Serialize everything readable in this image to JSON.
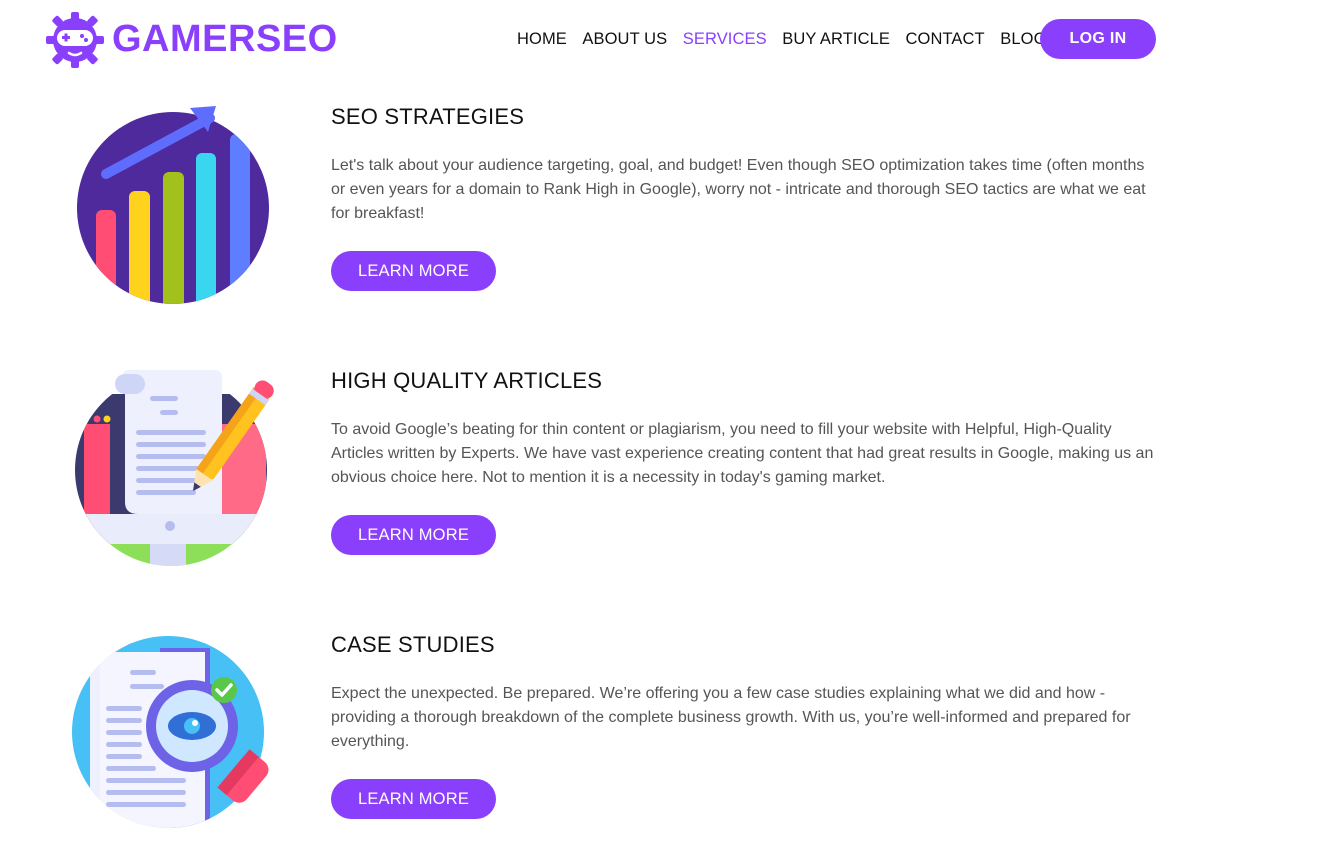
{
  "brand": {
    "name": "GAMERSEO",
    "logo_icon": "gamepad-gear-icon",
    "color": "#8a3ffc"
  },
  "nav": {
    "items": [
      {
        "label": "HOME",
        "active": false
      },
      {
        "label": "ABOUT US",
        "active": false
      },
      {
        "label": "SERVICES",
        "active": true
      },
      {
        "label": "BUY ARTICLE",
        "active": false
      },
      {
        "label": "CONTACT",
        "active": false
      },
      {
        "label": "BLOG",
        "active": false
      }
    ],
    "login_label": "LOG IN"
  },
  "services": [
    {
      "icon": "bar-chart-growth-icon",
      "title": "SEO STRATEGIES",
      "text": "Let's talk about your audience targeting, goal, and budget! Even though SEO optimization takes time (often months or even years for a domain to Rank High in Google), worry not - intricate and thorough SEO tactics are what we eat for breakfast!",
      "button": "LEARN MORE"
    },
    {
      "icon": "document-pencil-icon",
      "title": "HIGH QUALITY ARTICLES",
      "text": "To avoid Google’s beating for thin content or plagiarism, you need to fill your website with Helpful, High-Quality Articles written by Experts. We have vast experience creating content that had great results in Google, making us an obvious choice here. Not to mention it is a necessity in today's gaming market.",
      "button": "LEARN MORE"
    },
    {
      "icon": "document-magnifier-icon",
      "title": "CASE STUDIES",
      "text": "Expect the unexpected. Be prepared. We’re offering you a few case studies explaining what we did and how - providing a thorough breakdown of the complete business growth. With us, you’re well-informed and prepared for everything.",
      "button": "LEARN MORE"
    }
  ],
  "colors": {
    "accent": "#8a3ffc",
    "text": "#111111",
    "body_text": "#555555"
  }
}
